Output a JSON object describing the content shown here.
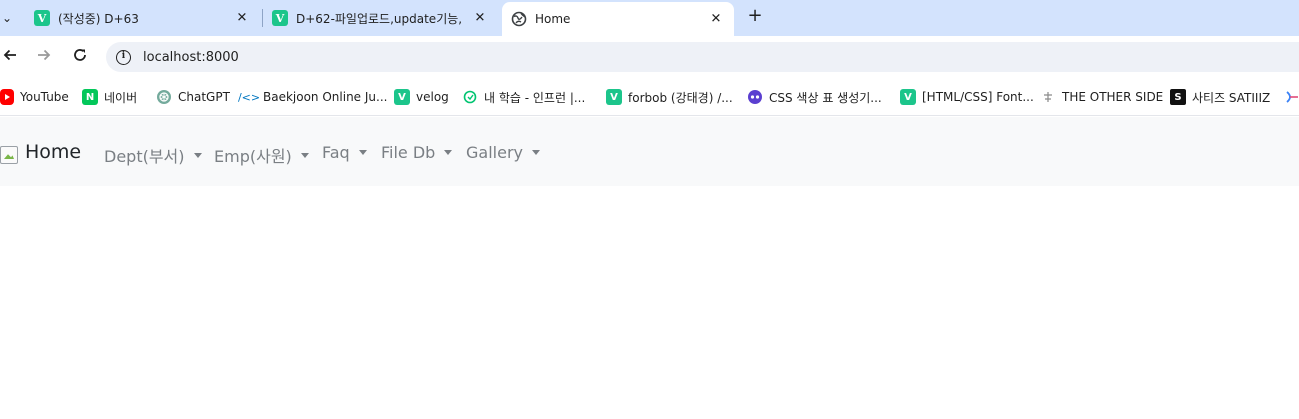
{
  "tabs": [
    {
      "title": "(작성중) D+63",
      "favicon": "velog-v-icon",
      "favicon_text": "V"
    },
    {
      "title": "D+62-파일업로드,update기능,",
      "favicon": "velog-v-icon",
      "favicon_text": "V"
    },
    {
      "title": "Home",
      "favicon": "globe-icon"
    }
  ],
  "tab_close_glyph": "✕",
  "new_tab_glyph": "+",
  "address": {
    "url": "localhost:8000"
  },
  "bookmarks": [
    {
      "label": "YouTube",
      "icon": "youtube-icon"
    },
    {
      "label": "네이버",
      "icon": "naver-icon",
      "icon_text": "N"
    },
    {
      "label": "ChatGPT",
      "icon": "chatgpt-icon"
    },
    {
      "label": "Baekjoon Online Ju...",
      "icon": "code-icon",
      "icon_text": "/<>"
    },
    {
      "label": "velog",
      "icon": "velog-v-icon",
      "icon_text": "V"
    },
    {
      "label": "내 학습 - 인프런 |...",
      "icon": "inflearn-icon"
    },
    {
      "label": "forbob (강태경) /...",
      "icon": "velog-v-icon",
      "icon_text": "V"
    },
    {
      "label": "CSS 색상 표 생성기...",
      "icon": "css-tool-icon"
    },
    {
      "label": "[HTML/CSS] Font...",
      "icon": "velog-v-icon",
      "icon_text": "V"
    },
    {
      "label": "THE OTHER SIDE",
      "icon": "the-other-side-icon"
    },
    {
      "label": "사티즈 SATIIIZ",
      "icon": "satiiiz-icon",
      "icon_text": "S"
    }
  ],
  "navbar": {
    "brand": "Home",
    "menus": [
      {
        "label": "Dept(부서)"
      },
      {
        "label": "Emp(사원)"
      },
      {
        "label": "Faq"
      },
      {
        "label": "File Db"
      },
      {
        "label": "Gallery"
      }
    ]
  },
  "colors": {
    "tabstrip": "#d3e3fd",
    "velog_green": "#1cc58b",
    "navbar_bg": "#f8f9fa",
    "nav_link": "#7a7f84"
  }
}
